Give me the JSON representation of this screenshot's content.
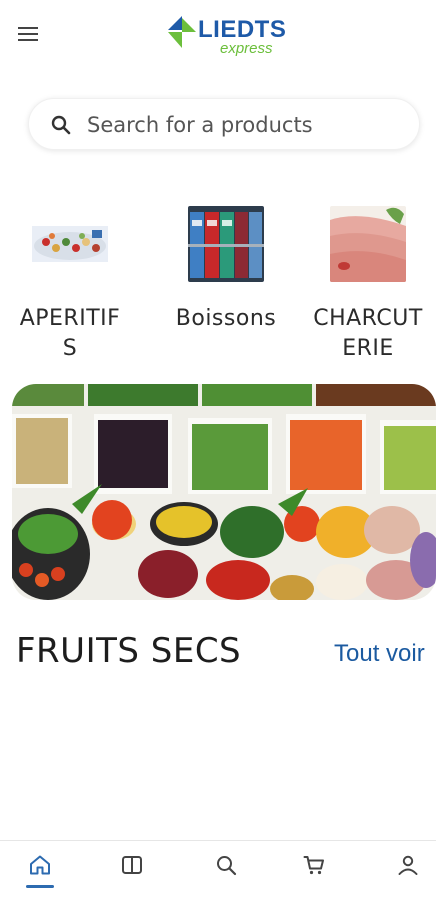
{
  "header": {
    "menu_icon": "hamburger-icon",
    "logo_text": "LIEDTS",
    "logo_sub": "express",
    "brand_blue": "#1e5aa8",
    "brand_green": "#6cbf3c"
  },
  "search": {
    "placeholder": "Search for a products",
    "icon": "search-icon"
  },
  "categories": [
    {
      "label": "APERITIFS",
      "image": "aperitif-platter-image"
    },
    {
      "label": "Boissons",
      "image": "drink-cans-image"
    },
    {
      "label": "CHARCUTERIE",
      "image": "sliced-ham-image"
    }
  ],
  "banner": {
    "image": "vegetable-salad-bar-image"
  },
  "section": {
    "title": "FRUITS SECS",
    "see_all": "Tout voir",
    "accent": "#1b5aa0"
  },
  "bottom_nav": {
    "items": [
      "home-icon",
      "catalog-icon",
      "search-icon",
      "cart-icon",
      "account-icon"
    ],
    "active": "home-icon"
  }
}
